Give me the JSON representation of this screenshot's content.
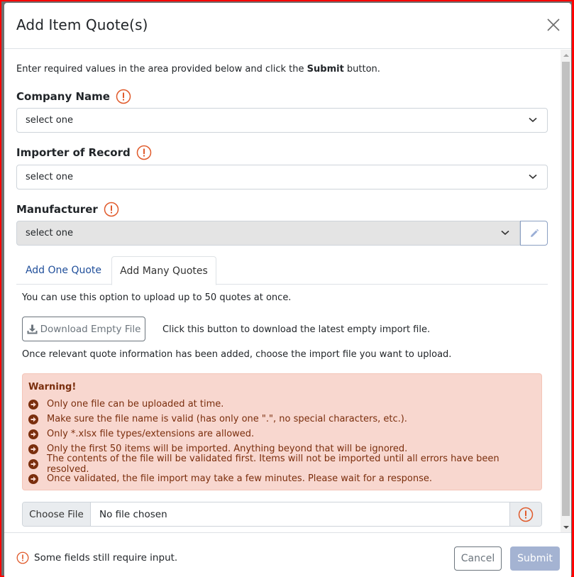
{
  "modal": {
    "title": "Add Item Quote(s)",
    "close_icon": "close-icon"
  },
  "intro": {
    "before": "Enter required values in the area provided below and click the ",
    "bold": "Submit",
    "after": " button."
  },
  "fields": {
    "company": {
      "label": "Company Name",
      "value": "select one"
    },
    "importer": {
      "label": "Importer of Record",
      "value": "select one"
    },
    "manufacturer": {
      "label": "Manufacturer",
      "value": "select one",
      "edit_icon": "pencil-icon"
    }
  },
  "tabs": [
    {
      "label": "Add One Quote",
      "active": false
    },
    {
      "label": "Add Many Quotes",
      "active": true
    }
  ],
  "many": {
    "intro": "You can use this option to upload up to 50 quotes at once.",
    "download_label": "Download Empty File",
    "download_hint": "Click this button to download the latest empty import file.",
    "choose_hint": "Once relevant quote information has been added, choose the import file you want to upload."
  },
  "warning": {
    "title": "Warning!",
    "items": [
      "Only one file can be uploaded at time.",
      "Make sure the file name is valid (has only one \".\", no special characters, etc.).",
      "Only *.xlsx file types/extensions are allowed.",
      "Only the first 50 items will be imported. Anything beyond that will be ignored.",
      "The contents of the file will be validated first. Items will not be imported until all errors have been resolved.",
      "Once validated, the file import may take a few minutes. Please wait for a response."
    ]
  },
  "file": {
    "button_label": "Choose File",
    "status": "No file chosen"
  },
  "footer": {
    "message": "Some fields still require input.",
    "cancel_label": "Cancel",
    "submit_label": "Submit"
  },
  "colors": {
    "required": "#e05a2b",
    "link": "#1f4e9a",
    "warning_bg": "#f8d7cf",
    "warning_text": "#7a2e0d",
    "submit_disabled": "#a4b3d2"
  }
}
